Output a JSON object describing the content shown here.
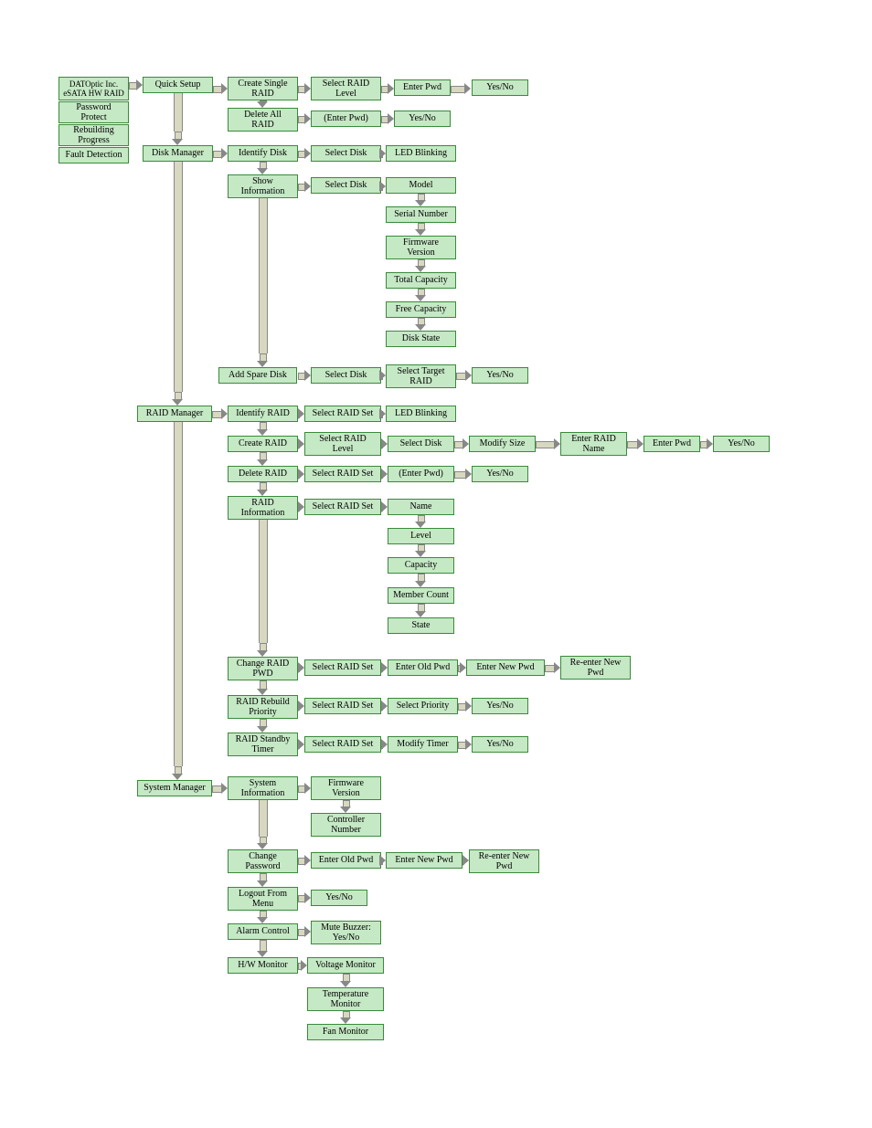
{
  "sidebar": {
    "title": "DATOptic Inc.\neSATA HW RAID",
    "rows": [
      "Password Protect",
      "Rebuilding Progress",
      "Fault Detection"
    ]
  },
  "c1": {
    "quick_setup": "Quick Setup",
    "disk_manager": "Disk Manager",
    "raid_manager": "RAID Manager",
    "system_manager": "System Manager"
  },
  "qs": {
    "create_single": "Create Single RAID",
    "select_level": "Select RAID Level",
    "enter_pwd": "Enter Pwd",
    "yn1": "Yes/No",
    "delete_all": "Delete All RAID",
    "enter_pwd2": "(Enter Pwd)",
    "yn2": "Yes/No"
  },
  "dm": {
    "identify": "Identify Disk",
    "sel_disk1": "Select Disk",
    "led": "LED Blinking",
    "show_info": "Show Information",
    "sel_disk2": "Select Disk",
    "model": "Model",
    "serial": "Serial Number",
    "fw": "Firmware Version",
    "total": "Total Capacity",
    "free": "Free Capacity",
    "state": "Disk State",
    "add_spare": "Add Spare Disk",
    "sel_disk3": "Select Disk",
    "sel_target": "Select Target RAID",
    "yn": "Yes/No"
  },
  "rm": {
    "identify": "Identify RAID",
    "sel1": "Select RAID Set",
    "led": "LED Blinking",
    "create": "Create RAID",
    "sel_level": "Select RAID Level",
    "sel_disk": "Select Disk",
    "modify_size": "Modify Size",
    "enter_name": "Enter RAID Name",
    "enter_pwd": "Enter Pwd",
    "yn1": "Yes/No",
    "delete": "Delete RAID",
    "sel2": "Select RAID Set",
    "enter_pwd2": "(Enter Pwd)",
    "yn2": "Yes/No",
    "info": "RAID Information",
    "sel3": "Select RAID Set",
    "name": "Name",
    "level": "Level",
    "capacity": "Capacity",
    "members": "Member Count",
    "state": "State",
    "change_pwd": "Change RAID PWD",
    "sel4": "Select RAID Set",
    "old_pwd": "Enter Old Pwd",
    "new_pwd": "Enter New Pwd",
    "re_pwd": "Re-enter New Pwd",
    "rebuild": "RAID Rebuild Priority",
    "sel5": "Select RAID Set",
    "sel_pri": "Select Priority",
    "yn3": "Yes/No",
    "standby": "RAID Standby Timer",
    "sel6": "Select RAID Set",
    "mod_timer": "Modify Timer",
    "yn4": "Yes/No"
  },
  "sm": {
    "sysinfo": "System Information",
    "fw": "Firmware Version",
    "ctrl": "Controller Number",
    "change_pwd": "Change Password",
    "old": "Enter Old Pwd",
    "newp": "Enter New Pwd",
    "rep": "Re-enter New Pwd",
    "logout": "Logout From Menu",
    "yn": "Yes/No",
    "alarm": "Alarm Control",
    "mute": "Mute Buzzer: Yes/No",
    "hw": "H/W Monitor",
    "volt": "Voltage Monitor",
    "temp": "Temperature Monitor",
    "fan": "Fan Monitor"
  }
}
